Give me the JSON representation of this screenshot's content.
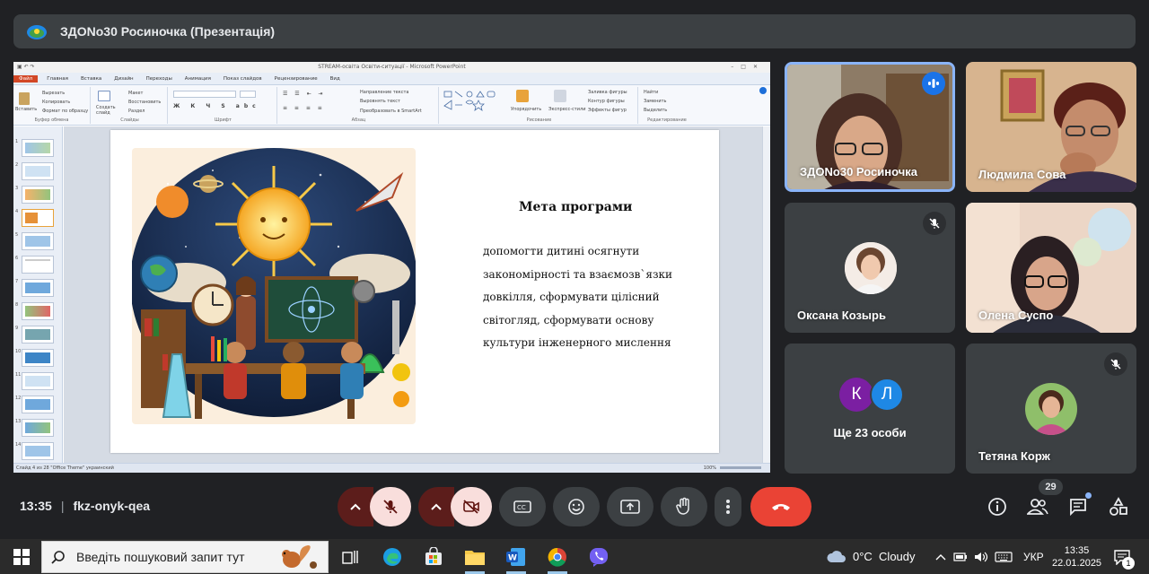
{
  "meeting": {
    "title": "ЗДОNo30 Росиночка (Презентація)",
    "time": "13:35",
    "code": "fkz-onyk-qea",
    "participant_count": "29"
  },
  "ppt": {
    "window_title": "STREAM-освіта Освіти-ситуації - Microsoft PowerPoint",
    "menu": [
      "Файл",
      "Главная",
      "Вставка",
      "Дизайн",
      "Переходы",
      "Анимация",
      "Показ слайдов",
      "Рецензирование",
      "Вид"
    ],
    "ribbon_groups": [
      "Буфер обмена",
      "Слайды",
      "Шрифт",
      "Абзац",
      "Рисование",
      "Редактирование"
    ],
    "ribbon_buttons": {
      "paste": "Вставить",
      "cut": "Вырезать",
      "copy": "Копировать",
      "format_painter": "Формат по образцу",
      "new_slide": "Создать слайд",
      "layout": "Макет",
      "reset": "Восстановить",
      "section": "Раздел",
      "arrange": "Упорядочить",
      "quick_styles": "Экспресс-стили",
      "shape_fill": "Заливка фигуры",
      "shape_outline": "Контур фигуры",
      "shape_effects": "Эффекты фигур",
      "find": "Найти",
      "replace": "Заменить",
      "select": "Выделить",
      "text_direction": "Направление текста",
      "align_text": "Выровнять текст",
      "smartart": "Преобразовать в SmartArt"
    },
    "status": "Слайд 4 из 28   \"Office Theme\"   украинский",
    "zoom": "100%",
    "slide_numbers": [
      "1",
      "2",
      "3",
      "4",
      "5",
      "6",
      "7",
      "8",
      "9",
      "10",
      "11",
      "12",
      "13",
      "14"
    ]
  },
  "slide": {
    "title": "Мета програми",
    "body": "допомогти дитині осягнути закономірності та взаємозв`язки довкілля, сформувати цілісний світогляд, сформувати основу культури інженерного мислення"
  },
  "participants": [
    {
      "name": "ЗДОNo30 Росиночка",
      "speaking": true
    },
    {
      "name": "Людмила Сова",
      "muted": false
    },
    {
      "name": "Оксана Козырь",
      "muted": true
    },
    {
      "name": "Олена Суспо",
      "muted": false
    },
    {
      "name": "Ще 23 особи",
      "initials": [
        "К",
        "Л"
      ],
      "colors": [
        "#7b1fa2",
        "#1e88e5"
      ]
    },
    {
      "name": "Тетяна Корж",
      "muted": true
    }
  ],
  "taskbar": {
    "search_placeholder": "Введіть пошуковий запит тут",
    "weather": "0°C  Cloudy",
    "language": "УКР",
    "clock_time": "13:35",
    "clock_date": "22.01.2025",
    "notification_count": "1"
  },
  "colors": {
    "meet_bg": "#202124",
    "tile_bg": "#3c4043",
    "hangup": "#ea4335",
    "speaking_border": "#8ab4f8"
  }
}
